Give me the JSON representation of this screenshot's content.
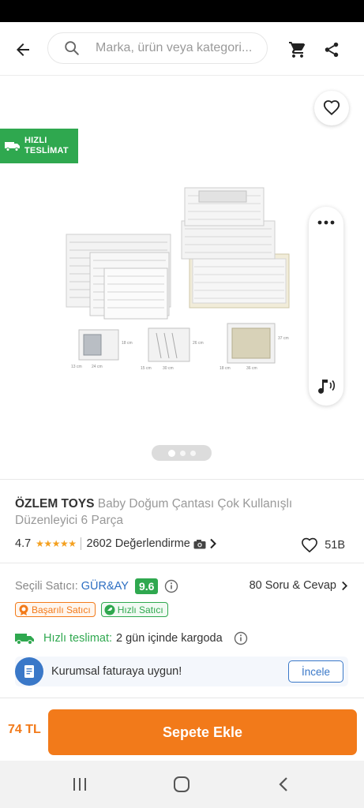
{
  "search": {
    "placeholder": "Marka, ürün veya kategori..."
  },
  "gallery": {
    "fast_badge_line1": "HIZLI",
    "fast_badge_line2": "TESLİMAT",
    "image_count": 3,
    "active_image": 1
  },
  "product": {
    "brand": "ÖZLEM TOYS",
    "name": "Baby Doğum Çantası Çok Kullanışlı Düzenleyici 6 Parça",
    "rating": "4.7",
    "stars_value": 4.7,
    "reviews": "2602 Değerlendirme",
    "favorites": "51B"
  },
  "seller": {
    "label": "Seçili Satıcı:",
    "name": "GÜR&AY",
    "score": "9.6",
    "qa_link": "80 Soru & Cevap",
    "badge_success": "Başarılı Satıcı",
    "badge_fast": "Hızlı Satıcı"
  },
  "delivery": {
    "label": "Hızlı teslimat:",
    "value": "2 gün içinde kargoda"
  },
  "corporate": {
    "text": "Kurumsal faturaya uygun!",
    "button": "İncele"
  },
  "bottom": {
    "price": "74 TL",
    "add_to_cart": "Sepete Ekle"
  },
  "colors": {
    "accent_orange": "#f27a1a",
    "green": "#2fa84f",
    "blue": "#3a78c8"
  }
}
